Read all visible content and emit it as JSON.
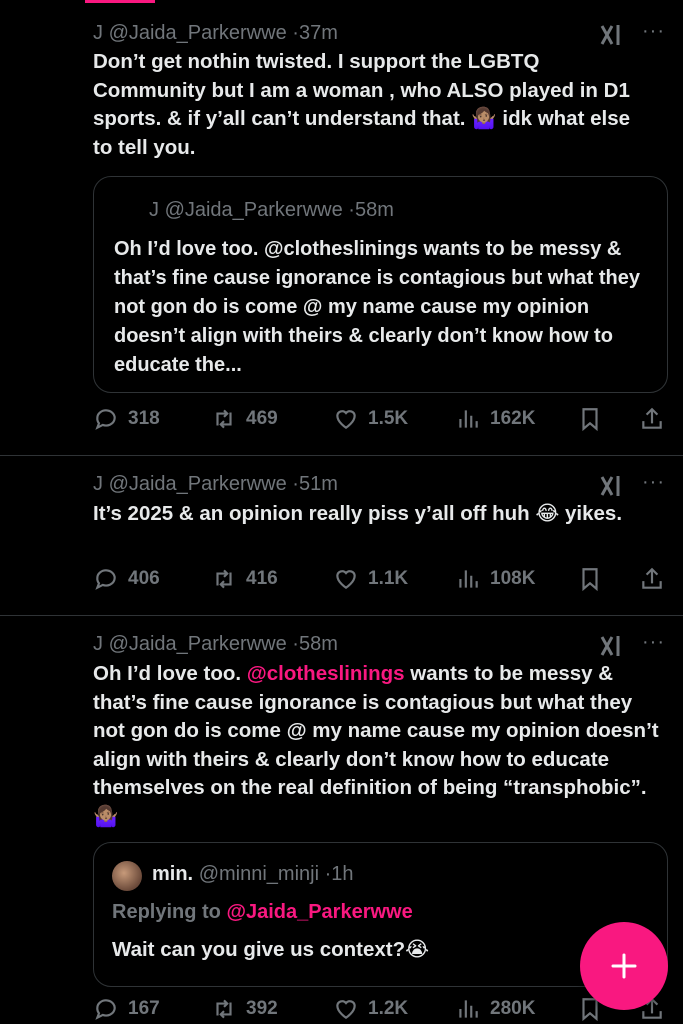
{
  "colors": {
    "accent": "#f91880",
    "text": "#e7e9ea",
    "muted": "#71767b",
    "border": "#2f3336",
    "background": "#000000"
  },
  "tweets": [
    {
      "author_initial": "J",
      "handle": "@Jaida_Parkerwwe",
      "time": "37m",
      "text": "Don’t get nothin twisted. I support the LGBTQ Community but I am a woman , who ALSO played in D1 sports. & if y’all can’t understand that. 🤷🏽‍♀️ idk what else to tell you.",
      "quote": {
        "author_initial": "J",
        "handle": "@Jaida_Parkerwwe",
        "time": "58m",
        "text": "Oh I’d love too. @clotheslinings wants to be messy & that’s fine cause ignorance  is contagious but what they not gon do is come @ my name cause my opinion doesn’t align with theirs & clearly don’t know how to educate the..."
      },
      "stats": {
        "replies": "318",
        "reposts": "469",
        "likes": "1.5K",
        "views": "162K"
      }
    },
    {
      "author_initial": "J",
      "handle": "@Jaida_Parkerwwe",
      "time": "51m",
      "text": "It’s 2025 & an opinion really piss y’all off huh 😂 yikes.",
      "stats": {
        "replies": "406",
        "reposts": "416",
        "likes": "1.1K",
        "views": "108K"
      }
    },
    {
      "author_initial": "J",
      "handle": "@Jaida_Parkerwwe",
      "time": "58m",
      "text_before": "Oh I’d love too. ",
      "text_mention": "@clotheslinings",
      "text_after": " wants to be messy & that’s fine cause ignorance  is contagious but what they not gon do is come @ my name cause my opinion doesn’t align with theirs & clearly don’t know how to educate themselves on the real definition of being “transphobic”. 🤷🏽‍♀️",
      "reply_card": {
        "name": "min.",
        "handle": "@minni_minji",
        "time": "1h",
        "replying_label": "Replying to",
        "replying_to": "@Jaida_Parkerwwe",
        "text": "Wait can you give us context?😭"
      },
      "stats": {
        "replies": "167",
        "reposts": "392",
        "likes": "1.2K",
        "views": "280K"
      }
    }
  ],
  "separator": "·",
  "more_label": "···",
  "icons": [
    "reply-icon",
    "repost-icon",
    "like-icon",
    "views-icon",
    "bookmark-icon",
    "share-icon",
    "grok-icon",
    "compose-plus-icon"
  ]
}
